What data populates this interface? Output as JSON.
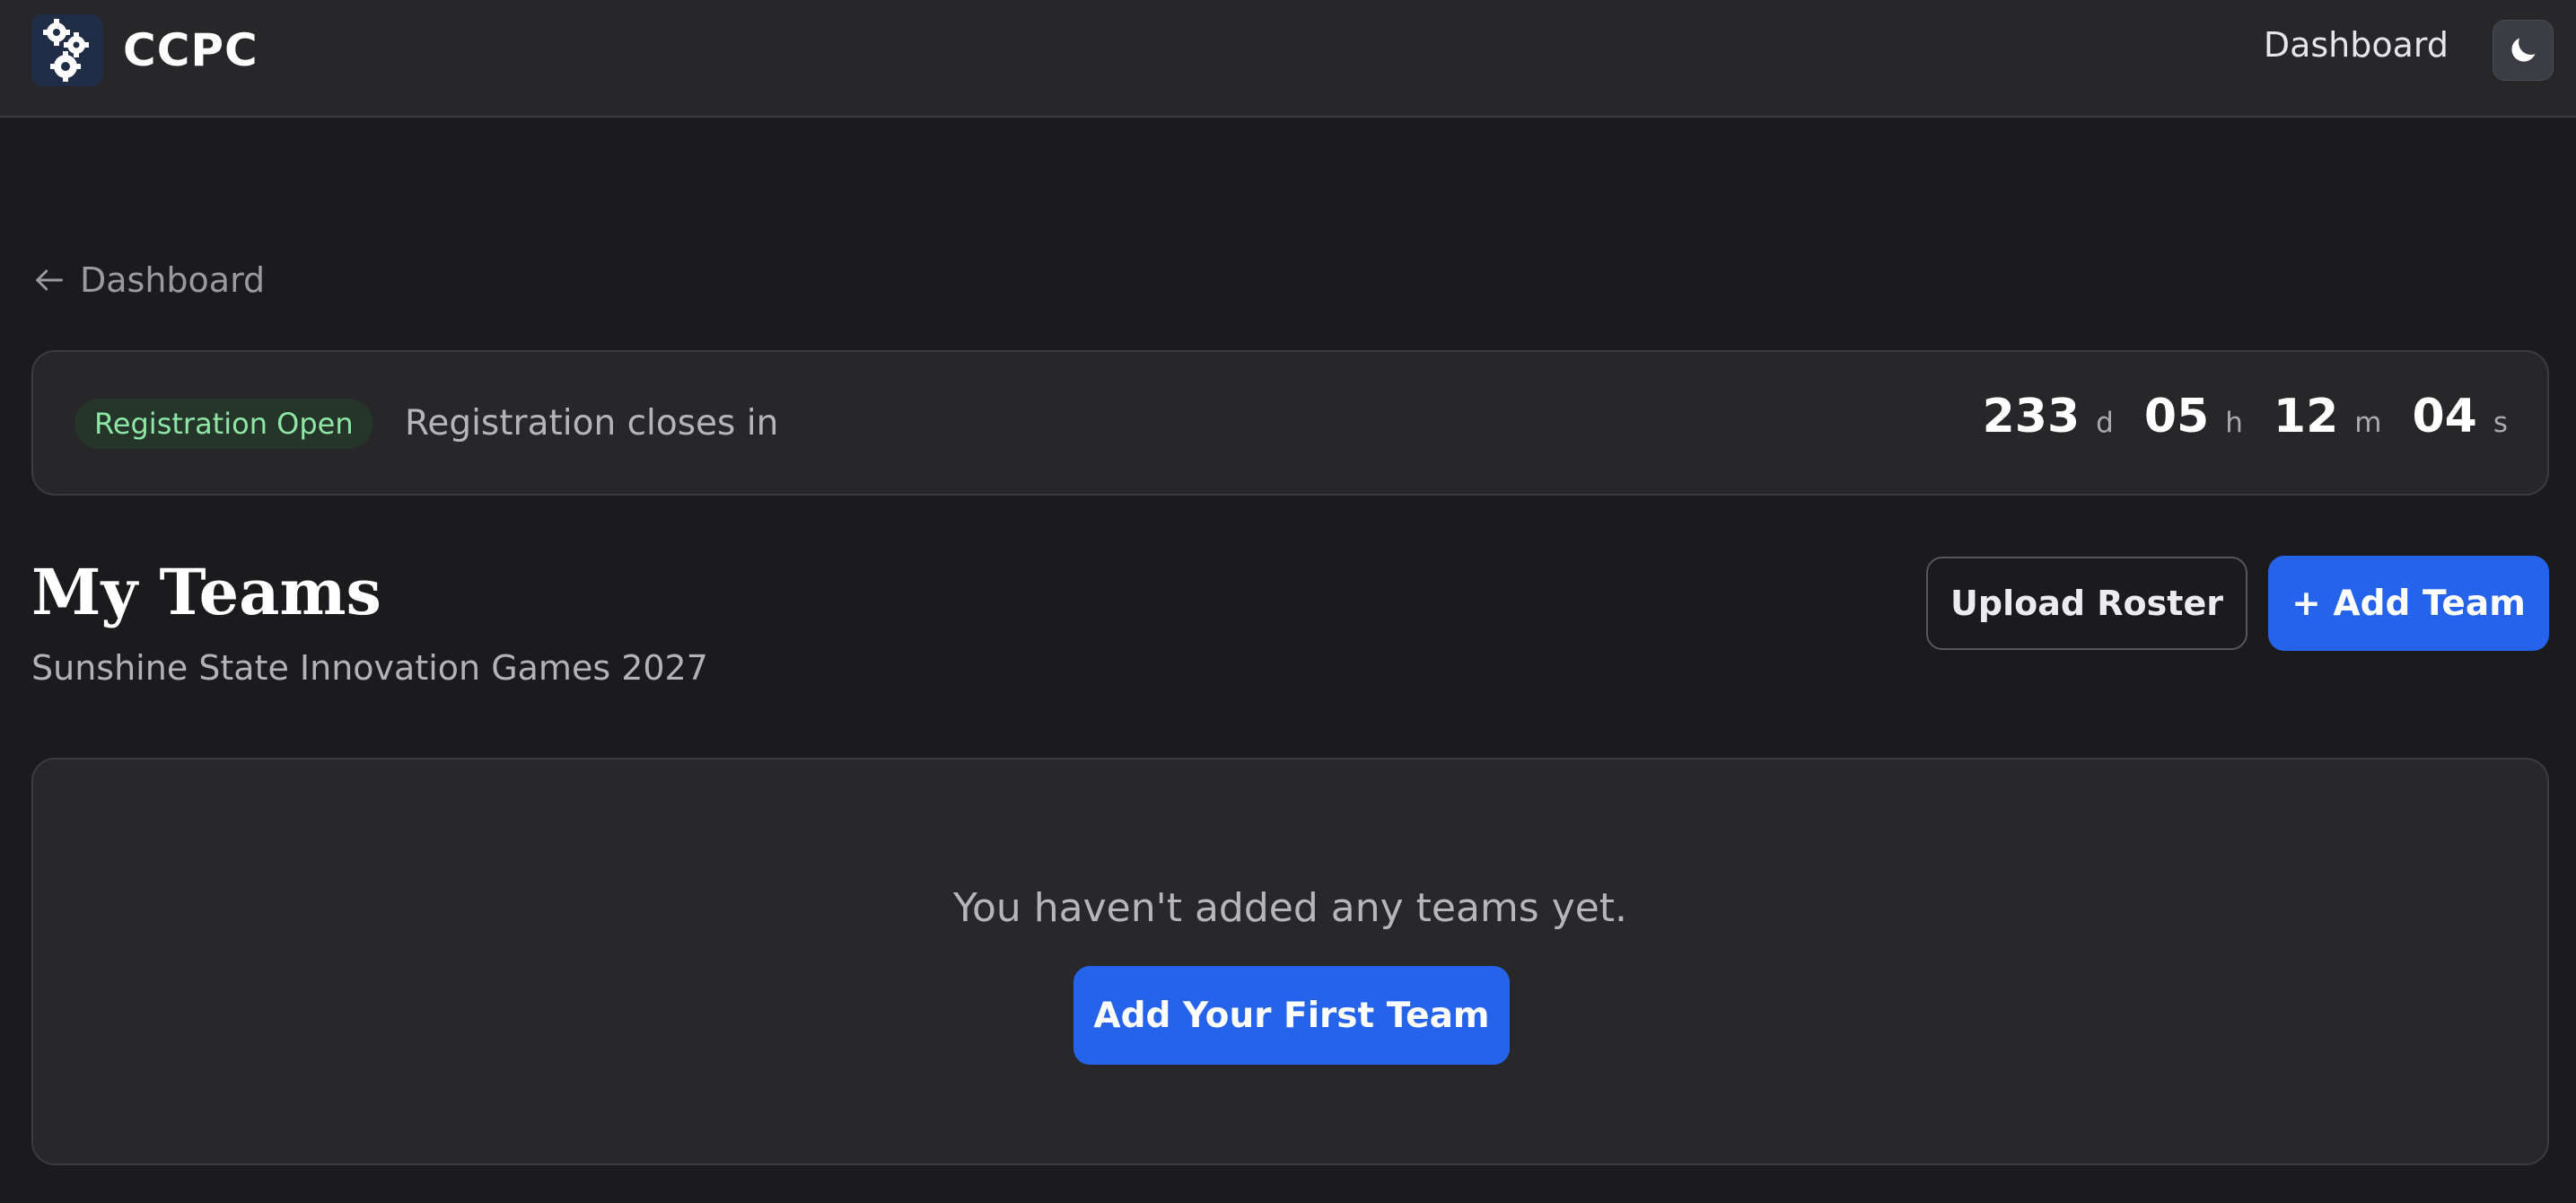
{
  "header": {
    "brand": "CCPC",
    "logo_icon": "gears-icon",
    "nav_dashboard": "Dashboard",
    "theme_icon": "moon-icon"
  },
  "back_link": {
    "label": "Dashboard",
    "icon": "arrow-left-icon"
  },
  "registration": {
    "badge": "Registration Open",
    "text": "Registration closes in",
    "countdown": {
      "days": "233",
      "days_unit": "d",
      "hours": "05",
      "hours_unit": "h",
      "minutes": "12",
      "minutes_unit": "m",
      "seconds": "04",
      "seconds_unit": "s"
    }
  },
  "teams": {
    "title": "My Teams",
    "subtitle": "Sunshine State Innovation Games 2027",
    "upload_label": "Upload Roster",
    "add_label": "+ Add Team",
    "empty_text": "You haven't added any teams yet.",
    "first_team_label": "Add Your First Team"
  },
  "colors": {
    "background": "#1b1b1d",
    "surface": "#27272a",
    "accent": "#2563eb",
    "badge_text": "#8ee6a5"
  }
}
